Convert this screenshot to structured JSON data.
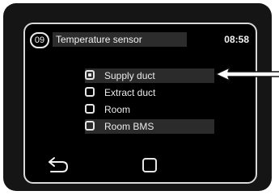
{
  "header": {
    "badge": "09",
    "title": "Temperature sensor",
    "time": "08:58"
  },
  "options": [
    {
      "label": "Supply duct",
      "checked": true,
      "highlighted": true
    },
    {
      "label": "Extract duct",
      "checked": false,
      "highlighted": false
    },
    {
      "label": "Room",
      "checked": false,
      "highlighted": false
    },
    {
      "label": "Room BMS",
      "checked": false,
      "highlighted": true
    }
  ],
  "footer": {
    "back_icon": "back-arrow-icon",
    "home_icon": "square-button-icon"
  },
  "annotation": {
    "icon": "arrow-left-icon"
  }
}
